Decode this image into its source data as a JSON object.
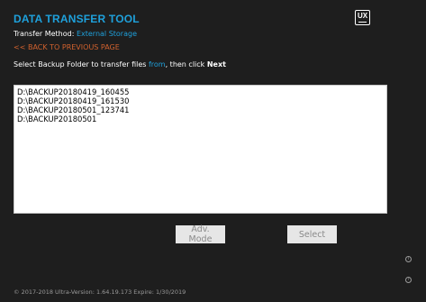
{
  "header": {
    "title": "DATA TRANSFER TOOL",
    "logo_text": "UX"
  },
  "method": {
    "label": "Transfer Method: ",
    "value": "External Storage"
  },
  "back_link": "<< BACK TO PREVIOUS PAGE",
  "instruction": {
    "part1": "Select Backup Folder to transfer files ",
    "from_word": "from",
    "part2": ", then click ",
    "bold_word": "Next"
  },
  "folders": [
    "D:\\BACKUP20180419_160455",
    "D:\\BACKUP20180419_161530",
    "D:\\BACKUP20180501_123741",
    "D:\\BACKUP20180501"
  ],
  "buttons": {
    "adv_mode": "Adv. Mode",
    "select": "Select"
  },
  "footer": "© 2017-2018 Ultra-Version: 1.64.19.173 Expire: 1/30/2019",
  "side_icons": {
    "info": "i",
    "help": "?"
  },
  "colors": {
    "background": "#1e1e1e",
    "accent": "#1ea1dc",
    "back_link": "#d2622e"
  }
}
